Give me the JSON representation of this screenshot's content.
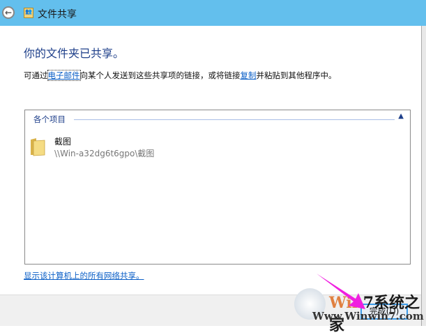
{
  "titlebar": {
    "title": "文件共享",
    "back_icon": "back-arrow-icon",
    "app_icon": "file-share-icon"
  },
  "main": {
    "heading": "你的文件夹已共享。",
    "desc_prefix": "可通过",
    "email_link": "电子邮件",
    "desc_mid": "向某个人发送到这些共享项的链接，或将链接",
    "copy_link": "复制",
    "desc_suffix": "并粘贴到其他程序中。"
  },
  "list": {
    "group_header": "各个项目",
    "items": [
      {
        "name": "截图",
        "path": "\\\\Win-a32dg6t6gpo\\截图",
        "icon": "folder-icon"
      }
    ]
  },
  "show_all_link": "显示该计算机上的所有网络共享。",
  "footer": {
    "finish_label": "完成(D)"
  },
  "watermark": {
    "line1": "Win7系统之家",
    "line2": "Www.Winwin7.com"
  },
  "colors": {
    "titlebar": "#63bfed",
    "heading": "#1e3f8a",
    "link": "#0b5fc7"
  }
}
